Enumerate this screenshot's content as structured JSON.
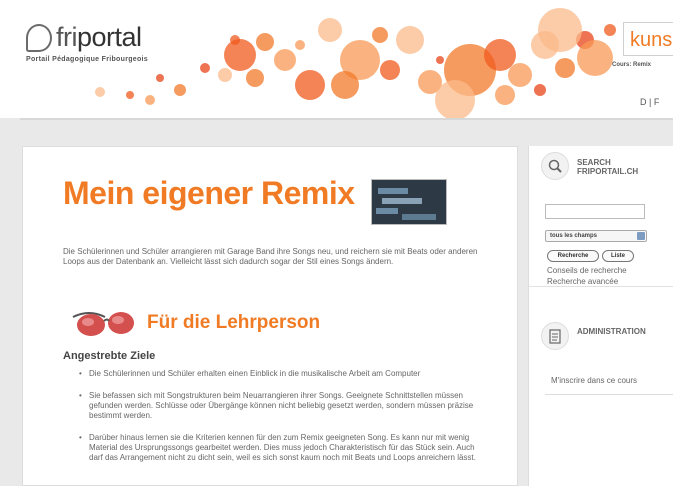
{
  "header": {
    "logo_text_a": "fri",
    "logo_text_b": "portal",
    "tagline": "Portail Pédagogique Fribourgeois",
    "search_value": "kuns",
    "search_label": "Cours: Remix",
    "lang": "D | F",
    "bubble_colors": [
      "#f05a1e",
      "#f27a2a",
      "#f89a55",
      "#fbb98a",
      "#e84419"
    ]
  },
  "main": {
    "title": "Mein eigener Remix",
    "intro": "Die Schülerinnen und Schüler arrangieren mit Garage Band ihre Songs neu, und reichern sie mit Beats oder anderen Loops aus der Datenbank an. Vielleicht lässt sich dadurch sogar der Stil eines Songs ändern.",
    "teacher_heading": "Für die Lehrperson",
    "goals_heading": "Angestrebte Ziele",
    "goals": [
      "Die Schülerinnen und Schüler erhalten einen Einblick in die musikalische Arbeit am Computer",
      "Sie befassen sich mit Songstrukturen beim Neuarrangieren ihrer Songs. Geeignete Schnittstellen müssen gefunden werden. Schlüsse oder Übergänge können nicht beliebig gesetzt werden, sondern müssen präzise bestimmt werden.",
      "Darüber hinaus lernen sie die Kriterien kennen für den zum Remix geeigneten Song. Es kann nur mit wenig Material des Ursprungssongs gearbeitet werden. Dies muss jedoch Charakteristisch für das Stück sein. Auch darf das Arrangement nicht zu dicht sein, weil es sich sonst kaum noch mit Beats und Loops anreichern lässt."
    ]
  },
  "sidebar": {
    "search_title_line1": "SEARCH",
    "search_title_line2": "FRIPORTAIL.CH",
    "search_value": "",
    "select_value": "tous les champs",
    "btn_search": "Recherche",
    "btn_list": "Liste",
    "link_tips": "Conseils de recherche",
    "link_advanced": "Recherche avancée",
    "admin_title": "ADMINISTRATION",
    "admin_item": "M'inscrire dans ce cours"
  },
  "accent_color": "#f07b24"
}
